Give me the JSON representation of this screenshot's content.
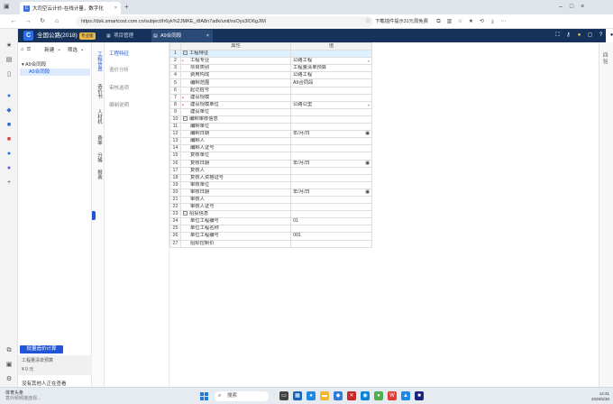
{
  "browser": {
    "tab_title": "大司空云计价-在线计量，数字化",
    "new_tab": "+",
    "url": "https://dsk.smartcost.com.cn/subject/h6yk%2JMKE_r8A8n7adk/unit/xsOys3lO6gJIM",
    "translate_notice": "下载插件提示31元周免费",
    "back": "←",
    "forward": "→",
    "reload": "↻",
    "home": "⌂"
  },
  "app": {
    "logo": "C",
    "title": "全国公路(2018)",
    "badge": "专业版",
    "tab_project": "项目管理",
    "tab_contract": "A9合同段",
    "tab_close": "×"
  },
  "tree": {
    "toolbar": [
      "⌂",
      "☰",
      "新建",
      "⌄",
      "筛选",
      "⌄"
    ],
    "root": "A9合同段",
    "leaf": "A9合同段",
    "calc_button": "批量造价计算",
    "bill_name": "工程量清单预算",
    "bill_value": "¥ 0 元",
    "others_viewing": "没有其他人正在查看"
  },
  "vtabs": [
    "工程信息",
    "造价书",
    "人材机",
    "费率",
    "分摊",
    "报表"
  ],
  "submenu": [
    "工程特征",
    "造价分析",
    "审核选项",
    "编制说明"
  ],
  "grid": {
    "headers": [
      "属性",
      "值"
    ],
    "rows": [
      {
        "n": "1",
        "name": "工程特征",
        "value": "",
        "group": true,
        "indent": 0
      },
      {
        "n": "2",
        "name": "工程专业",
        "value": "公路工程",
        "indent": 1,
        "required": true,
        "drop": true
      },
      {
        "n": "3",
        "name": "项目类别",
        "value": "工程量清单预算",
        "indent": 1
      },
      {
        "n": "4",
        "name": "费用构成",
        "value": "公路工程",
        "indent": 1
      },
      {
        "n": "5",
        "name": "编制范围",
        "value": "A9合同段",
        "indent": 1
      },
      {
        "n": "6",
        "name": "起讫桩号",
        "value": "",
        "indent": 1
      },
      {
        "n": "7",
        "name": "建设规模",
        "value": "",
        "indent": 1,
        "required": true
      },
      {
        "n": "8",
        "name": "建设规模单位",
        "value": "公路公里",
        "indent": 1,
        "required": true,
        "drop": true
      },
      {
        "n": "9",
        "name": "建设单位",
        "value": "",
        "indent": 1
      },
      {
        "n": "10",
        "name": "编制审核信息",
        "value": "",
        "group": true,
        "indent": 0
      },
      {
        "n": "11",
        "name": "编制单位",
        "value": "",
        "indent": 1
      },
      {
        "n": "12",
        "name": "编制日期",
        "value": "年/月/日",
        "indent": 1,
        "cal": true
      },
      {
        "n": "13",
        "name": "编制人",
        "value": "",
        "indent": 1
      },
      {
        "n": "14",
        "name": "编制人证号",
        "value": "",
        "indent": 1
      },
      {
        "n": "15",
        "name": "复核单位",
        "value": "",
        "indent": 1
      },
      {
        "n": "16",
        "name": "复核日期",
        "value": "年/月/日",
        "indent": 1,
        "cal": true
      },
      {
        "n": "17",
        "name": "复核人",
        "value": "",
        "indent": 1
      },
      {
        "n": "18",
        "name": "复核人资格证号",
        "value": "",
        "indent": 1
      },
      {
        "n": "19",
        "name": "审核单位",
        "value": "",
        "indent": 1
      },
      {
        "n": "20",
        "name": "审核日期",
        "value": "年/月/日",
        "indent": 1,
        "cal": true
      },
      {
        "n": "21",
        "name": "审核人",
        "value": "",
        "indent": 1
      },
      {
        "n": "22",
        "name": "审核人证号",
        "value": "",
        "indent": 1
      },
      {
        "n": "23",
        "name": "招投信息",
        "value": "",
        "group": true,
        "indent": 0
      },
      {
        "n": "24",
        "name": "单位工程编号",
        "value": "01",
        "indent": 1
      },
      {
        "n": "25",
        "name": "单位工程名称",
        "value": "",
        "indent": 1
      },
      {
        "n": "26",
        "name": "单位工程编号",
        "value": "001",
        "indent": 1
      },
      {
        "n": "27",
        "name": "招标控制价",
        "value": "",
        "indent": 1
      }
    ]
  },
  "rsidebar": {
    "label": "四\n验"
  },
  "taskbar": {
    "news_title": "体育头条",
    "news_sub": "意外频频接连现...",
    "search": "搜索",
    "time": "14:31",
    "date": "2025/5/30"
  },
  "colors": {
    "accent": "#2255d6",
    "header": "#16325a",
    "selected": "#dff0ff"
  }
}
